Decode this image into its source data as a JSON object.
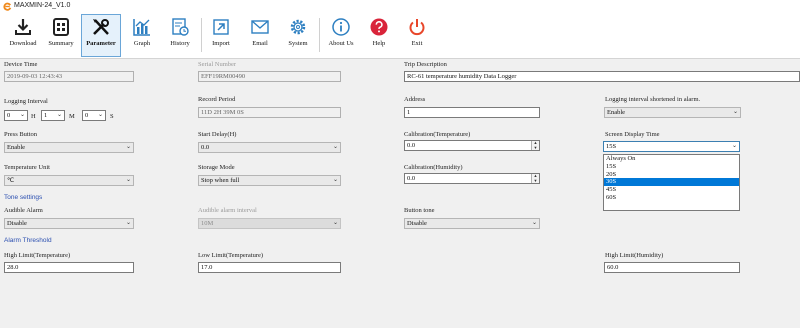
{
  "window": {
    "title": "MAXMIN-24_V1.0"
  },
  "toolbar": {
    "buttons": [
      {
        "label": "Download",
        "icon": "download-icon"
      },
      {
        "label": "Summary",
        "icon": "summary-icon"
      },
      {
        "label": "Parameter",
        "icon": "tools-icon"
      },
      {
        "label": "Graph",
        "icon": "graph-icon"
      },
      {
        "label": "History",
        "icon": "history-icon"
      },
      {
        "label": "Import",
        "icon": "import-icon"
      },
      {
        "label": "Email",
        "icon": "email-icon"
      },
      {
        "label": "System",
        "icon": "gear-icon"
      },
      {
        "label": "About Us",
        "icon": "info-icon"
      },
      {
        "label": "Help",
        "icon": "help-icon"
      },
      {
        "label": "Exit",
        "icon": "power-icon"
      }
    ],
    "active": "Parameter"
  },
  "form": {
    "device_time": {
      "label": "Device Time",
      "value": "2019-09-03 12:43:43"
    },
    "serial_number": {
      "label": "Serial Number",
      "value": "EFF19RM00490"
    },
    "trip_description": {
      "label": "Trip Description",
      "value": "RC-61 temperature humidity Data Logger"
    },
    "logging_interval": {
      "label": "Logging Interval",
      "hours": "0",
      "h_unit": "H",
      "minutes": "1",
      "m_unit": "M",
      "seconds": "0",
      "s_unit": "S"
    },
    "record_period": {
      "label": "Record Period",
      "value": "11D 2H 39M 0S"
    },
    "address": {
      "label": "Address",
      "value": "1"
    },
    "logging_shortened": {
      "label": "Logging interval shortened in alarm.",
      "value": "Enable"
    },
    "press_button": {
      "label": "Press Button",
      "value": "Enable"
    },
    "start_delay": {
      "label": "Start Delay(H)",
      "value": "0.0"
    },
    "calibration_temperature": {
      "label": "Calibration(Temperature)",
      "value": "0.0"
    },
    "screen_display_time": {
      "label": "Screen Display Time",
      "value": "15S",
      "options": [
        "Always On",
        "15S",
        "20S",
        "30S",
        "45S",
        "60S"
      ],
      "highlighted": "30S"
    },
    "temperature_unit": {
      "label": "Temperature Unit",
      "value": "℃"
    },
    "storage_mode": {
      "label": "Storage Mode",
      "value": "Stop when full"
    },
    "calibration_humidity": {
      "label": "Calibration(Humidity)",
      "value": "0.0"
    }
  },
  "tone_settings": {
    "title": "Tone settings",
    "audible_alarm": {
      "label": "Audible Alarm",
      "value": "Disable"
    },
    "audible_alarm_interval": {
      "label": "Audible alarm interval",
      "value": "10M"
    },
    "button_tone": {
      "label": "Button tone",
      "value": "Disable"
    }
  },
  "alarm_threshold": {
    "title": "Alarm Threshold",
    "high_limit_temperature": {
      "label": "High Limit(Temperature)",
      "value": "28.0"
    },
    "low_limit_temperature": {
      "label": "Low Limit(Temperature)",
      "value": "17.0"
    },
    "high_limit_humidity": {
      "label": "High Limit(Humidity)",
      "value": "60.0"
    }
  }
}
